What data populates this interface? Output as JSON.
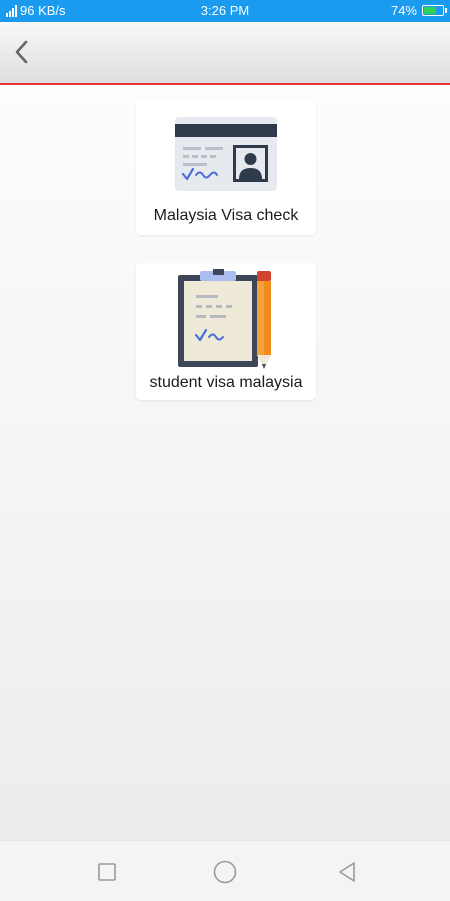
{
  "status_bar": {
    "network_speed": "96 KB/s",
    "time": "3:26 PM",
    "battery_level": "74%",
    "battery_fraction": 0.74,
    "battery_color": "#2fd25a",
    "icons": [
      "signal-icon",
      "battery-charging-icon"
    ]
  },
  "toolbar": {
    "back_icon": "chevron-left-icon",
    "accent_line_color": "#e53935"
  },
  "cards": [
    {
      "label": "Malaysia Visa check",
      "icon": "id-card-icon"
    },
    {
      "label": "student visa malaysia",
      "icon": "clipboard-pencil-icon"
    }
  ],
  "nav_bar": {
    "icons": [
      "recent-apps-icon",
      "home-icon",
      "back-triangle-icon"
    ]
  }
}
